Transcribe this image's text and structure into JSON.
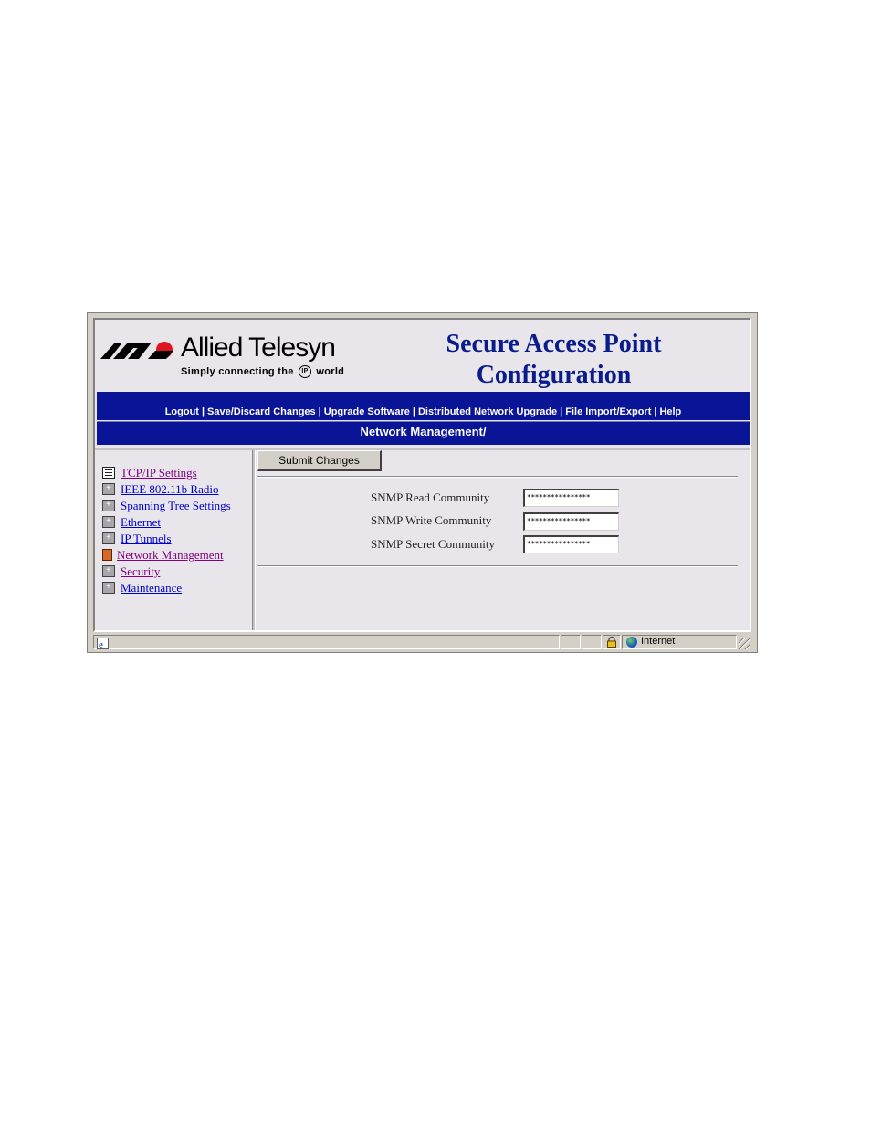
{
  "brand": {
    "logo_name": "Allied Telesyn",
    "tagline_pre": "Simply connecting the",
    "tagline_badge": "IP",
    "tagline_post": "world"
  },
  "header": {
    "title_line1": "Secure Access Point",
    "title_line2": "Configuration"
  },
  "nav": {
    "links": [
      "Logout",
      "Save/Discard Changes",
      "Upgrade Software",
      "Distributed Network Upgrade",
      "File Import/Export",
      "Help"
    ]
  },
  "section": {
    "title": "Network Management/"
  },
  "sidebar": {
    "items": [
      {
        "label": "TCP/IP Settings",
        "icon": "document-icon",
        "state": "visited"
      },
      {
        "label": "IEEE 802.11b Radio",
        "icon": "folder-icon",
        "state": "normal"
      },
      {
        "label": "Spanning Tree Settings",
        "icon": "folder-icon",
        "state": "normal"
      },
      {
        "label": "Ethernet",
        "icon": "folder-icon",
        "state": "normal"
      },
      {
        "label": "IP Tunnels",
        "icon": "folder-icon",
        "state": "normal"
      },
      {
        "label": "Network Management",
        "icon": "document-active-icon",
        "state": "active"
      },
      {
        "label": "Security",
        "icon": "folder-icon",
        "state": "visited"
      },
      {
        "label": "Maintenance",
        "icon": "folder-icon",
        "state": "normal"
      }
    ]
  },
  "content": {
    "submit_label": "Submit Changes",
    "fields": [
      {
        "label": "SNMP Read Community",
        "value": "****************"
      },
      {
        "label": "SNMP Write Community",
        "value": "****************"
      },
      {
        "label": "SNMP Secret Community",
        "value": "****************"
      }
    ]
  },
  "statusbar": {
    "zone": "Internet"
  },
  "colors": {
    "nav_blue": "#0a1496",
    "title_blue": "#0a1c8c",
    "link": "#0000cc",
    "visited": "#800080"
  }
}
